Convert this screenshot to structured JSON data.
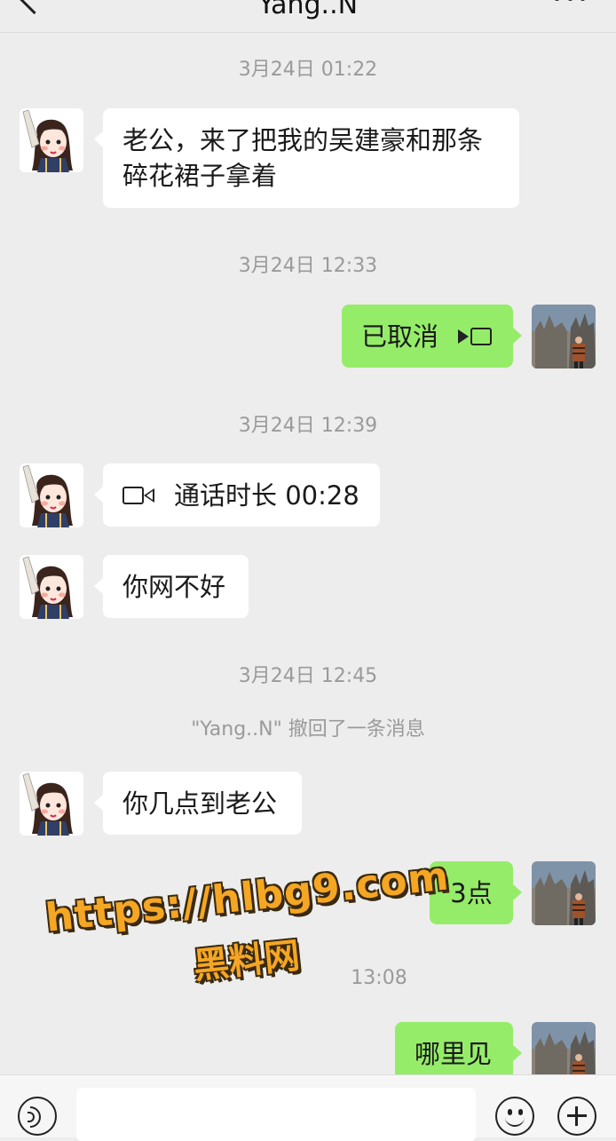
{
  "header": {
    "title": "Yang..N"
  },
  "messages": {
    "ts1": "3月24日 01:22",
    "m1_line1": "老公，来了把我的吴建豪和那条",
    "m1_line2": "碎花裙子拿着",
    "ts2": "3月24日 12:33",
    "m2": "已取消",
    "ts3": "3月24日 12:39",
    "m3": "通话时长 00:28",
    "m4": "你网不好",
    "ts4": "3月24日 12:45",
    "sys1": "\"Yang..N\" 撤回了一条消息",
    "m5": "你几点到老公",
    "m6": "3点",
    "ts5": "13:08",
    "m7": "哪里见"
  },
  "watermark": {
    "url": "https://hlbg9.com",
    "text": "黑料网"
  },
  "colors": {
    "background": "#ededed",
    "sent_bubble": "#95ec69",
    "received_bubble": "#ffffff",
    "watermark": "#f5a623"
  },
  "icons": [
    "back-icon",
    "more-icon",
    "video-call-icon",
    "voice-icon",
    "emoji-icon",
    "plus-icon"
  ]
}
